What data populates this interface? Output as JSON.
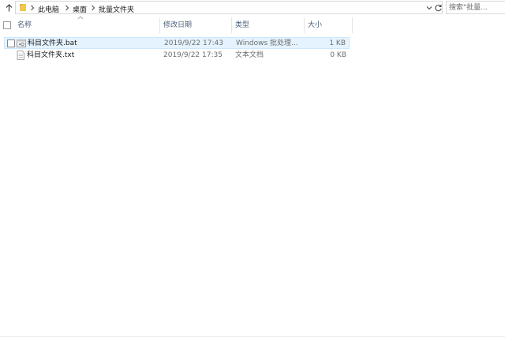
{
  "breadcrumb": {
    "items": [
      "此电脑",
      "桌面",
      "批量文件夹"
    ]
  },
  "search": {
    "placeholder": "搜索\"批量..."
  },
  "columns": {
    "name": "名称",
    "date": "修改日期",
    "type": "类型",
    "size": "大小"
  },
  "files": [
    {
      "name": "科目文件夹.bat",
      "date": "2019/9/22 17:43",
      "type": "Windows 批处理...",
      "size": "1 KB",
      "icon": "batch-file-icon",
      "selected": true
    },
    {
      "name": "科目文件夹.txt",
      "date": "2019/9/22 17:35",
      "type": "文本文档",
      "size": "0 KB",
      "icon": "text-file-icon",
      "selected": false
    }
  ],
  "colors": {
    "selection_bg": "#e5f3ff",
    "selection_border": "#cce8ff",
    "header_text": "#4c607a",
    "folder": "#f0c850"
  }
}
